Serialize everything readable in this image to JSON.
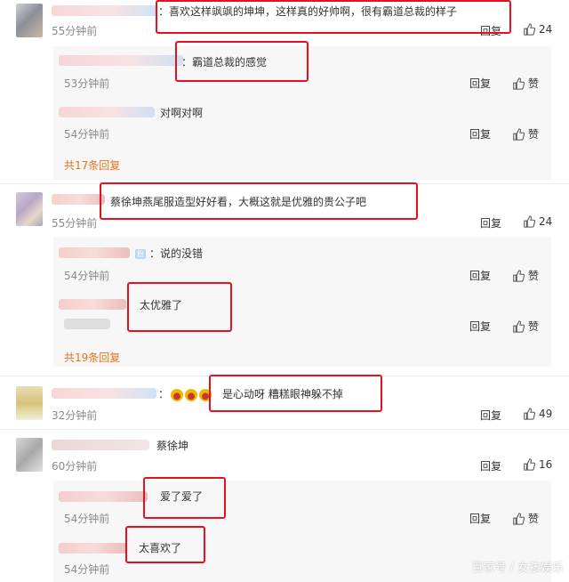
{
  "colors": {
    "accent_orange": "#e8721a",
    "highlight_red": "#e8101e",
    "reply_bg": "#f7f7f7"
  },
  "actions": {
    "reply": "回复",
    "like": "赞"
  },
  "comments": [
    {
      "text": "：喜欢这样飒飒的坤坤，这样真的好帅啊，很有霸道总裁的样子",
      "time": "55分钟前",
      "likes": "24",
      "replies": [
        {
          "text": "：霸道总裁的感觉",
          "time": "53分钟前"
        },
        {
          "text": "对啊对啊",
          "time": "54分钟前"
        }
      ],
      "more": "共17条回复"
    },
    {
      "text": "蔡徐坤燕尾服造型好好看，大概这就是优雅的贵公子吧",
      "time": "55分钟前",
      "likes": "24",
      "replies": [
        {
          "badge": "粉",
          "text": "：说的没错",
          "time": "54分钟前"
        },
        {
          "text": "太优雅了",
          "time": ""
        }
      ],
      "more": "共19条回复"
    },
    {
      "text": "：",
      "text2": "是心动呀 糟糕眼神躲不掉",
      "time": "32分钟前",
      "likes": "49",
      "replies": []
    },
    {
      "text": "蔡徐坤",
      "time": "60分钟前",
      "likes": "16",
      "replies": [
        {
          "text": "爱了爱了",
          "time": "54分钟前"
        },
        {
          "text": "太喜欢了",
          "time": "54分钟前"
        }
      ]
    }
  ],
  "watermark": "百家号 / 女孩娱乐"
}
